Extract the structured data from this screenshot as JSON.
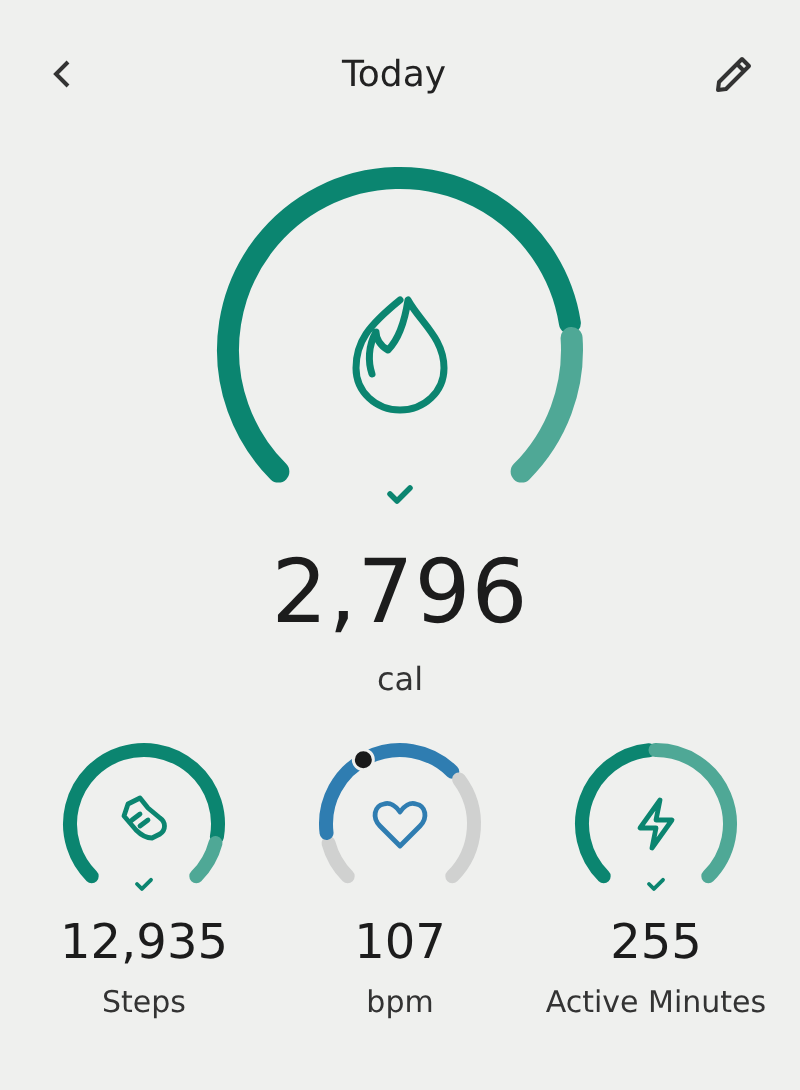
{
  "header": {
    "title": "Today"
  },
  "main": {
    "value": "2,796",
    "unit": "cal",
    "goal_met": true
  },
  "tiles": [
    {
      "kind": "steps",
      "value": "12,935",
      "label": "Steps",
      "goal_met": true
    },
    {
      "kind": "heartrate",
      "value": "107",
      "label": "bpm"
    },
    {
      "kind": "activity",
      "value": "255",
      "label": "Active Minutes",
      "goal_met": true
    }
  ]
}
